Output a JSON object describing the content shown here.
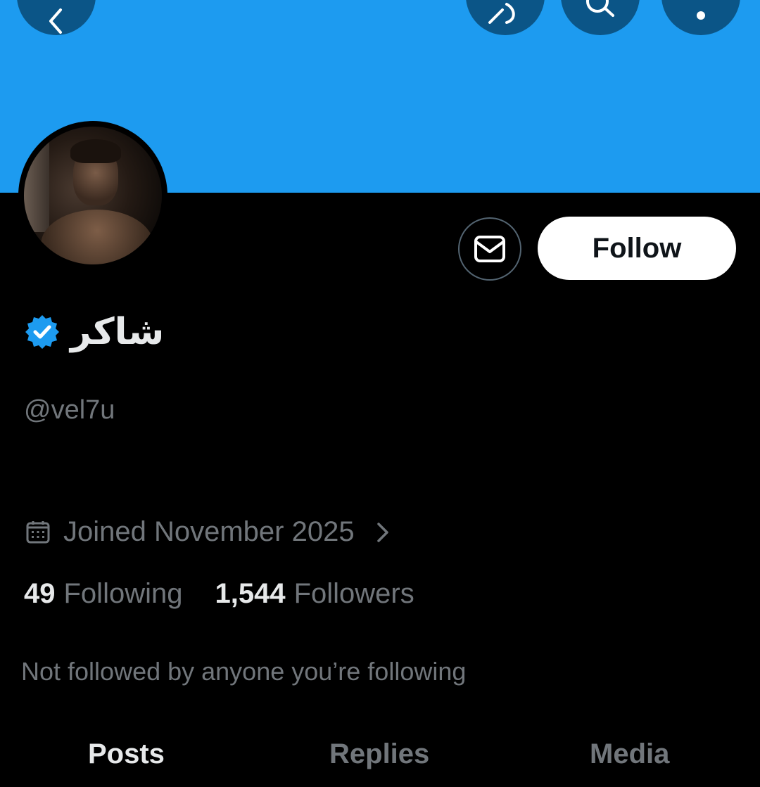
{
  "profile": {
    "display_name": "شاكر",
    "handle": "@vel7u",
    "verified_badge_icon": "verified-badge-icon",
    "joined": "Joined November 2025",
    "following_count": "49",
    "following_label": "Following",
    "followers_count": "1,544",
    "followers_label": "Followers",
    "mutuals_note": "Not followed by anyone you’re following"
  },
  "actions": {
    "follow_label": "Follow",
    "message_icon": "mail-icon"
  },
  "header_icons": [
    "back-arrow-icon",
    "grok-icon",
    "search-icon",
    "more-icon"
  ],
  "tabs": [
    {
      "label": "Posts",
      "active": true
    },
    {
      "label": "Replies",
      "active": false
    },
    {
      "label": "Media",
      "active": false
    }
  ],
  "colors": {
    "banner": "#1d9bf0",
    "header_button_bg": "#0b5587",
    "verified_badge": "#1d9bf0",
    "text_primary": "#e7e9ea",
    "text_secondary": "#71767b",
    "background": "#000000"
  }
}
